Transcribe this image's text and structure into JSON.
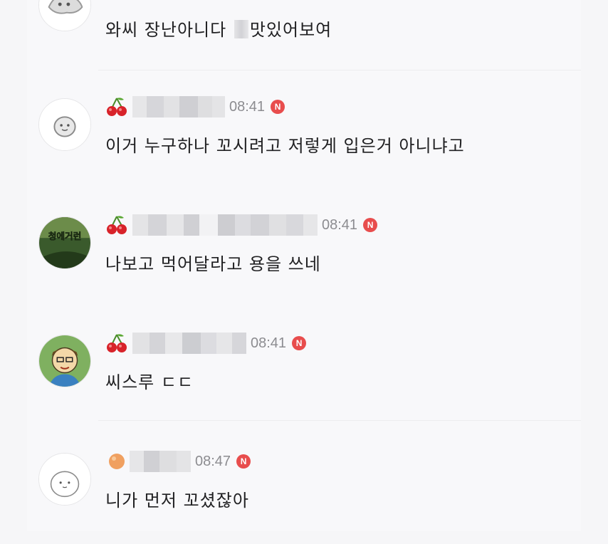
{
  "comments": [
    {
      "time": "",
      "text_before": "와씨 장난아니다 ",
      "text_after": "맛있어보여",
      "badge": ""
    },
    {
      "time": "08:41",
      "text": "이거 누구하나 꼬시려고 저렇게 입은거 아니냐고",
      "badge": "N"
    },
    {
      "time": "08:41",
      "text": "나보고 먹어달라고 용을 쓰네",
      "badge": "N"
    },
    {
      "time": "08:41",
      "text": "씨스루 ㄷㄷ",
      "badge": "N"
    },
    {
      "time": "08:47",
      "text": "니가 먼저 꼬셨잖아",
      "badge": "N"
    }
  ],
  "avatars": {
    "c3": "청에거런"
  },
  "icons": {
    "grade": "cherry-icon",
    "new": "new-badge-icon"
  },
  "colors": {
    "new_badge": "#e84d4d",
    "time": "#8c8c90",
    "text": "#202022"
  }
}
